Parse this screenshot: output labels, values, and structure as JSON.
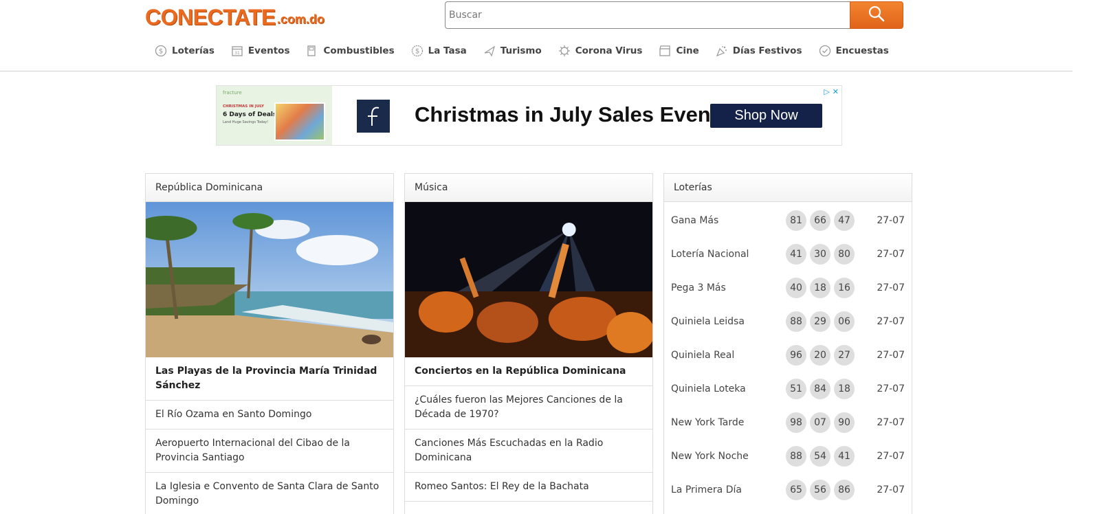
{
  "header": {
    "logo_main": "CONECTATE",
    "logo_tld": ".com.do",
    "search_placeholder": "Buscar"
  },
  "nav": {
    "items": [
      {
        "label": "Loterías",
        "icon": "coin-icon"
      },
      {
        "label": "Eventos",
        "icon": "calendar-icon"
      },
      {
        "label": "Combustibles",
        "icon": "fuel-icon"
      },
      {
        "label": "La Tasa",
        "icon": "dollar-icon"
      },
      {
        "label": "Turismo",
        "icon": "airplane-icon"
      },
      {
        "label": "Corona Virus",
        "icon": "virus-icon"
      },
      {
        "label": "Cine",
        "icon": "film-icon"
      },
      {
        "label": "Días Festivos",
        "icon": "party-icon"
      },
      {
        "label": "Encuestas",
        "icon": "check-circle-icon"
      }
    ]
  },
  "ad": {
    "thumb_brand": "fracture",
    "thumb_line1": "CHRISTMAS IN JULY",
    "thumb_line2": "6 Days of Deals",
    "thumb_line3": "Land Huge Savings Today!",
    "headline": "Christmas in July Sales Event",
    "cta": "Shop Now",
    "choices_icons": [
      "adchoices-icon",
      "close-icon"
    ]
  },
  "panels": {
    "rd": {
      "title": "República Dominicana",
      "stories": [
        "Las Playas de la Provincia María Trinidad Sánchez",
        "El Río Ozama en Santo Domingo",
        "Aeropuerto Internacional del Cibao de la Provincia Santiago",
        "La Iglesia e Convento de Santa Clara de Santo Domingo"
      ]
    },
    "musica": {
      "title": "Música",
      "stories": [
        "Conciertos en la República Dominicana",
        "¿Cuáles fueron las Mejores Canciones de la Década de 1970?",
        "Canciones Más Escuchadas en la Radio Dominicana",
        "Romeo Santos: El Rey de la Bachata"
      ]
    },
    "loterias": {
      "title": "Loterías",
      "rows": [
        {
          "name": "Gana Más",
          "n1": "81",
          "n2": "66",
          "n3": "47",
          "date": "27-07"
        },
        {
          "name": "Lotería Nacional",
          "n1": "41",
          "n2": "30",
          "n3": "80",
          "date": "27-07"
        },
        {
          "name": "Pega 3 Más",
          "n1": "40",
          "n2": "18",
          "n3": "16",
          "date": "27-07"
        },
        {
          "name": "Quiniela Leidsa",
          "n1": "88",
          "n2": "29",
          "n3": "06",
          "date": "27-07"
        },
        {
          "name": "Quiniela Real",
          "n1": "96",
          "n2": "20",
          "n3": "27",
          "date": "27-07"
        },
        {
          "name": "Quiniela Loteka",
          "n1": "51",
          "n2": "84",
          "n3": "18",
          "date": "27-07"
        },
        {
          "name": "New York Tarde",
          "n1": "98",
          "n2": "07",
          "n3": "90",
          "date": "27-07"
        },
        {
          "name": "New York Noche",
          "n1": "88",
          "n2": "54",
          "n3": "41",
          "date": "27-07"
        },
        {
          "name": "La Primera Día",
          "n1": "65",
          "n2": "56",
          "n3": "86",
          "date": "27-07"
        }
      ]
    }
  },
  "colors": {
    "brand_orange": "#ea6a20",
    "ad_navy": "#142148",
    "ball_gray": "#dedede"
  }
}
